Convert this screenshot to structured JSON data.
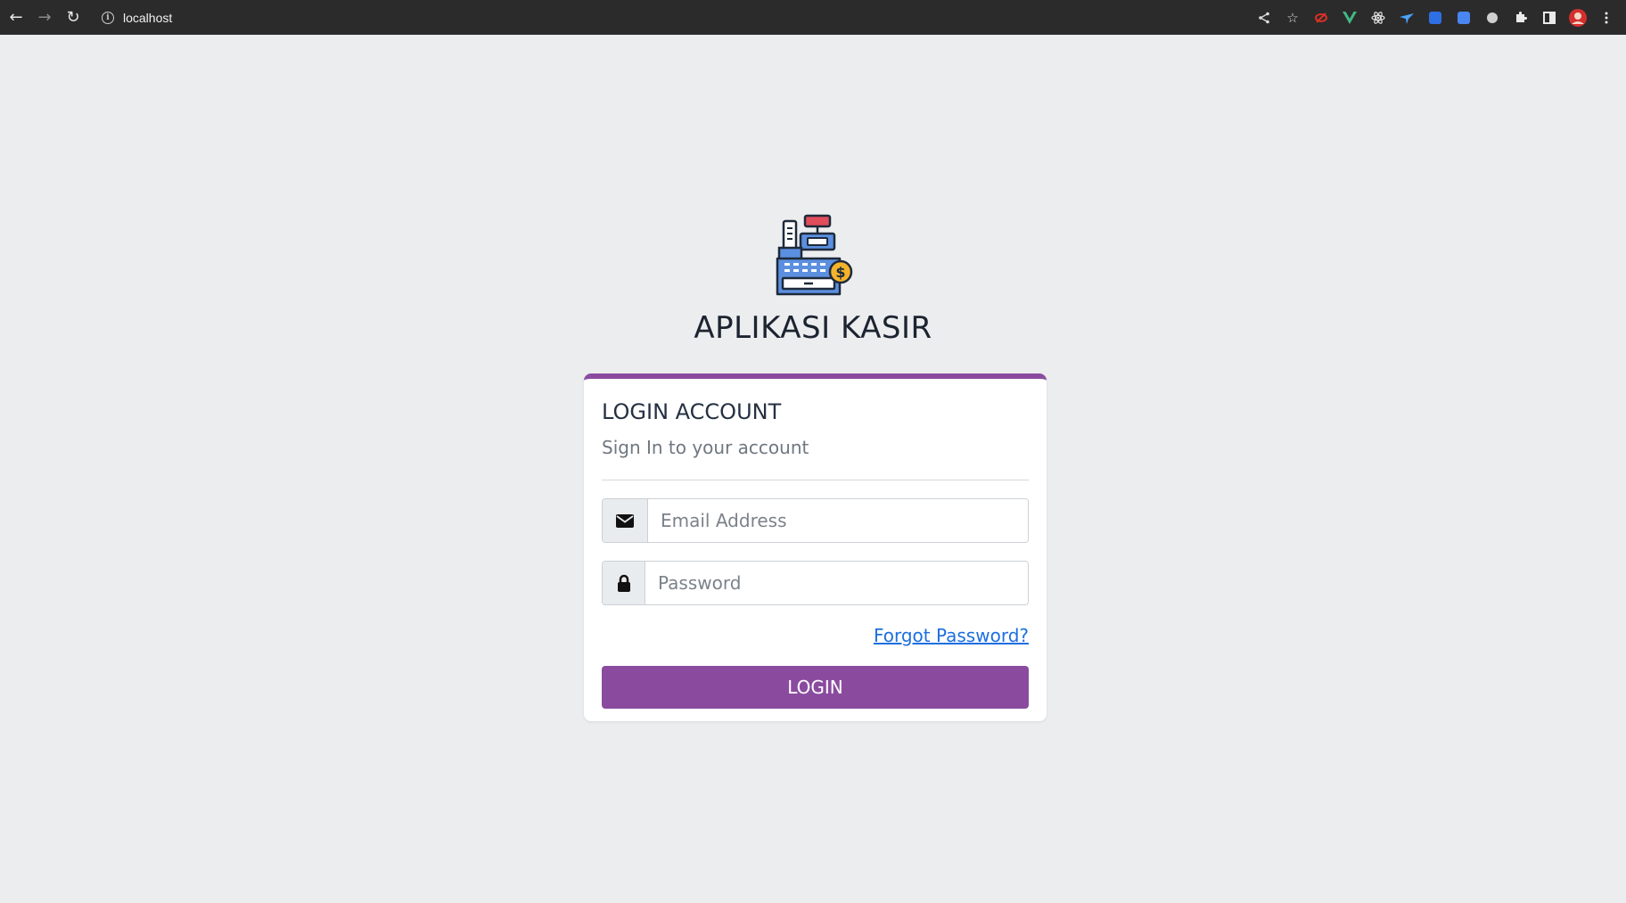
{
  "browser": {
    "url": "localhost"
  },
  "app": {
    "title": "APLIKASI KASIR",
    "logo_icon": "cash-register-icon"
  },
  "login": {
    "heading": "LOGIN ACCOUNT",
    "subheading": "Sign In to your account",
    "email_placeholder": "Email Address",
    "password_placeholder": "Password",
    "forgot_label": "Forgot Password?",
    "button_label": "LOGIN"
  },
  "colors": {
    "accent": "#8a4b9f",
    "link": "#1d6fe0",
    "page_bg": "#ecedef",
    "browser_bar": "#2b2b2b"
  }
}
